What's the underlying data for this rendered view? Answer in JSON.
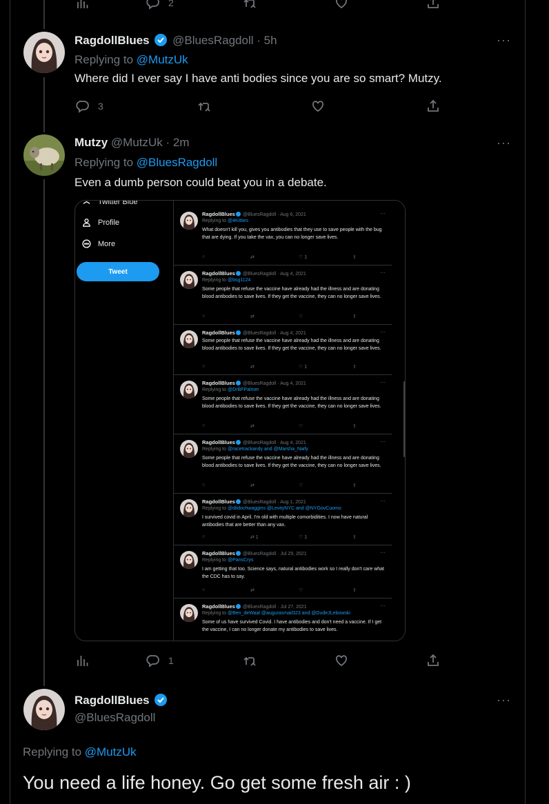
{
  "top_actions": {
    "reply_count": "2"
  },
  "tweet1": {
    "name": "RagdollBlues",
    "handle": "@BluesRagdoll",
    "time": "5h",
    "replying_prefix": "Replying to ",
    "replying_to": "@MutzUk",
    "text": "Where did I ever say I have anti bodies since you are so smart?  Mutzy.",
    "reply_count": "3"
  },
  "tweet2": {
    "name": "Mutzy",
    "handle": "@MutzUk",
    "time": "2m",
    "replying_prefix": "Replying to ",
    "replying_to": "@BluesRagdoll",
    "text": "Even a dumb person could beat you in a debate.",
    "reply_count": "1"
  },
  "embed": {
    "sidebar": {
      "twitter_blue": "Twitter Blue",
      "profile": "Profile",
      "more": "More",
      "tweet_button": "Tweet"
    },
    "tweets": [
      {
        "name": "RagdollBlues",
        "meta": "@BluesRagdoll · Aug 6, 2021",
        "reply": "@4Kitties",
        "text": "What doesn't kill you, gives you antibodies that they use to save people with the bug that are dying. If you take the vax, you can no longer save lives.",
        "likes": "1",
        "rts": ""
      },
      {
        "name": "RagdollBlues",
        "meta": "@BluesRagdoll · Aug 4, 2021",
        "reply": "@bsg1124",
        "text": "Some people that refuse the vaccine have already had the illness and are donating blood antibodies to save lives. If they get the vaccine, they can no longer save lives.",
        "likes": "",
        "rts": ""
      },
      {
        "name": "RagdollBlues",
        "meta": "@BluesRagdoll · Aug 4, 2021",
        "reply": "",
        "text": "Some people that refuse the vaccine have already had the illness and are donating blood antibodies to save lives. If they get the vaccine, they can no longer save lives.",
        "likes": "1",
        "rts": ""
      },
      {
        "name": "RagdollBlues",
        "meta": "@BluesRagdoll · Aug 4, 2021",
        "reply": "@DrBFPalmer",
        "text": "Some people that refuse the vaccine have already had the illness and are donating blood antibodies to save lives. If they get the vaccine, they can no longer save lives.",
        "likes": "",
        "rts": ""
      },
      {
        "name": "RagdollBlues",
        "meta": "@BluesRagdoll · Aug 4, 2021",
        "reply": "@racetrackandy and @Marsha_Naify",
        "text": "Some people that refuse the vaccine have already had the illness and are donating blood antibodies to save lives. If they get the vaccine, they can no longer save lives.",
        "likes": "",
        "rts": ""
      },
      {
        "name": "RagdollBlues",
        "meta": "@BluesRagdoll · Aug 1, 2021",
        "reply": "@dildochwaggins @LevityNYC and @NYGovCuomo",
        "text": "I survived covid in April. I'm old with multiple comorbidities. I now have natural antibodies that are better than any vax.",
        "likes": "1",
        "rts": "1"
      },
      {
        "name": "RagdollBlues",
        "meta": "@BluesRagdoll · Jul 29, 2021",
        "reply": "@PansCrys",
        "text": "I am getting that too.  Science says, natural antibodies work so I really don't care what the CDC has to say.",
        "likes": "",
        "rts": ""
      },
      {
        "name": "RagdollBlues",
        "meta": "@BluesRagdoll · Jul 27, 2021",
        "reply": "@Ben_deWaal @augurasmail323 and @DudeJLebowski",
        "text": "Some of us have survived Covid. I have antibodies and don't need a vaccine. If I get the vaccine, I can no longer donate my antibodies to save lives.",
        "likes": "",
        "rts": ""
      }
    ],
    "replying_prefix": "Replying to "
  },
  "tweet3": {
    "name": "RagdollBlues",
    "handle": "@BluesRagdoll",
    "replying_prefix": "Replying to ",
    "replying_to": "@MutzUk",
    "text": "You need a life honey. Go get some fresh air : )"
  },
  "more_label": "···",
  "colors": {
    "accent": "#1d9bf0",
    "muted": "#71767b",
    "text": "#e7e9ea",
    "border": "#2f3336"
  }
}
